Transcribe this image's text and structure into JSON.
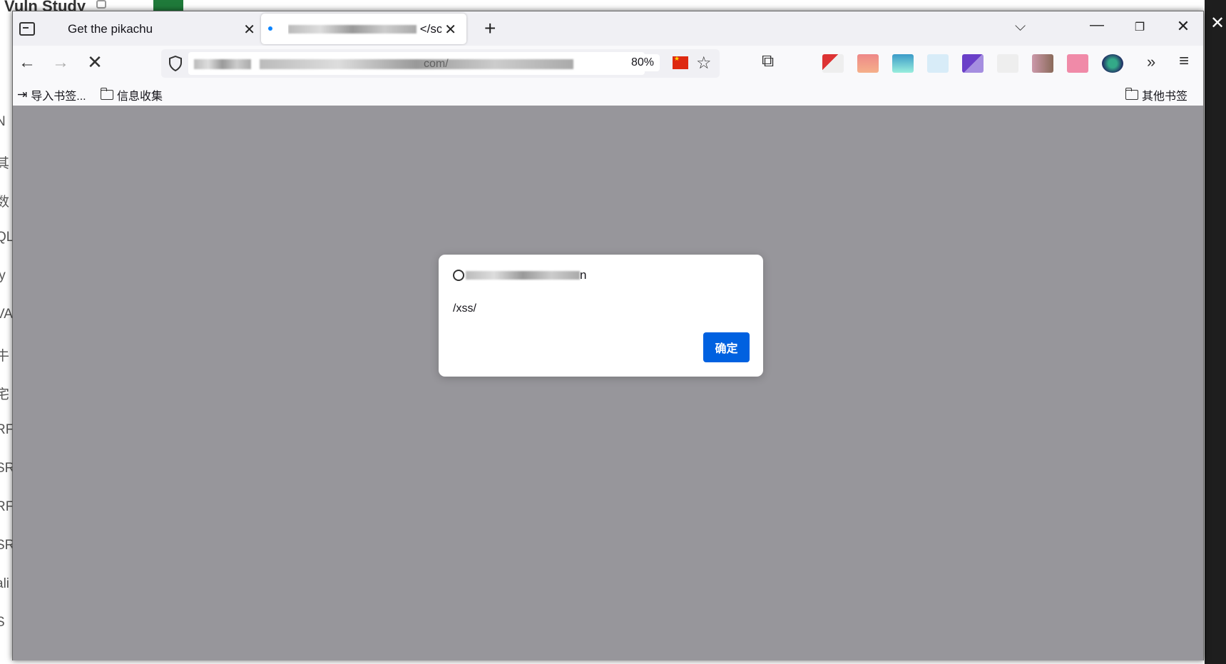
{
  "background_app": {
    "title": "Vuln Study",
    "side_fragments": [
      "N",
      "其",
      "数",
      "QL",
      "ly",
      "VA",
      "牛",
      "宅",
      "RF",
      "SR",
      "RF",
      "SR",
      "ali",
      "S"
    ]
  },
  "browser": {
    "tabs": [
      {
        "label": "Get the pikachu",
        "close_label": "✕"
      },
      {
        "label": "</sc",
        "close_label": "✕",
        "loading": true
      }
    ],
    "new_tab_label": "+",
    "window_controls": {
      "minimize": "—",
      "restore": "❐",
      "close": "✕"
    },
    "nav": {
      "back": "←",
      "forward": "→",
      "stop": "✕"
    },
    "url": {
      "visible_fragment": "com/",
      "zoom": "80%"
    },
    "toolbar_icons": [
      "shield-icon",
      "flag-cn-icon",
      "star-icon",
      "extensions-puzzle-icon",
      "overflow-chevron-icon",
      "hamburger-menu-icon"
    ],
    "bookmarks": {
      "import_label": "导入书签...",
      "folder_label": "信息收集",
      "other_label": "其他书签"
    }
  },
  "dialog": {
    "origin_suffix": "n",
    "message": "/xss/",
    "ok_label": "确定"
  },
  "colors": {
    "dialog_button": "#0061e0",
    "content_overlay": "#97969b",
    "tab_bar": "#f0f0f4",
    "loading_dot": "#0a84ff"
  }
}
